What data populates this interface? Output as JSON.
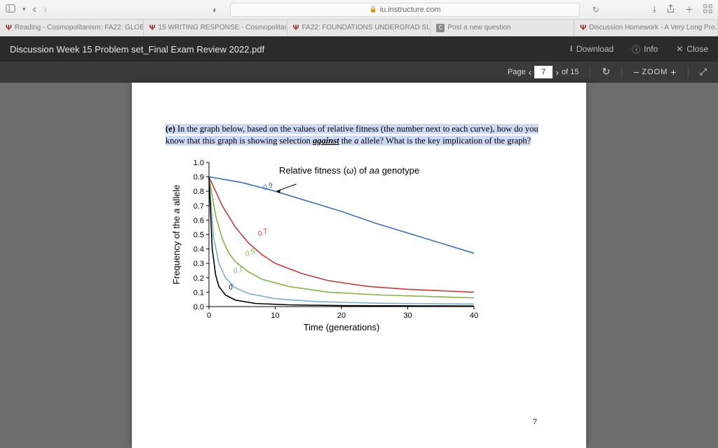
{
  "browser": {
    "url": "iu.instructure.com",
    "tabs": [
      {
        "icon": "psi",
        "label": "Reading - Cosmopolitanism: FA22: GLOB..."
      },
      {
        "icon": "psi",
        "label": "15 WRITING RESPONSE - Cosmopolitani..."
      },
      {
        "icon": "psi",
        "label": "FA22: FOUNDATIONS UNDERGRAD SUC..."
      },
      {
        "icon": "c",
        "label": "Post a new question"
      },
      {
        "icon": "psi",
        "label": "Discussion Homework - A Very Long Pro..."
      }
    ]
  },
  "viewer": {
    "title": "Discussion Week 15 Problem set_Final Exam Review 2022.pdf",
    "download": "Download",
    "info": "Info",
    "close": "Close",
    "page_label": "Page",
    "page_current": "7",
    "page_total": "of 15",
    "zoom_label": "ZOOM"
  },
  "document": {
    "question_label": "(e)",
    "question_part1": "In the graph below, based on the values of relative fitness (the number next to each curve), how do you know that this graph is showing selection ",
    "against": "against",
    "question_part2": " the ",
    "allele": "a",
    "question_part3": " allele?  What is the key implication of the graph?",
    "page_number": "7"
  },
  "chart_data": {
    "type": "line",
    "title": "Relative fitness (ω) of aa genotype",
    "xlabel": "Time (generations)",
    "ylabel": "Frequency of the a allele",
    "xlim": [
      0,
      40
    ],
    "ylim": [
      0,
      1.0
    ],
    "xticks": [
      0,
      10,
      20,
      30,
      40
    ],
    "yticks": [
      0.0,
      0.1,
      0.2,
      0.3,
      0.4,
      0.5,
      0.6,
      0.7,
      0.8,
      0.9,
      1.0
    ],
    "series": [
      {
        "name": "0.9",
        "color": "#3a6fb7",
        "label_pos": [
          9,
          0.82
        ],
        "points": [
          [
            0,
            0.9
          ],
          [
            5,
            0.86
          ],
          [
            10,
            0.8
          ],
          [
            15,
            0.73
          ],
          [
            20,
            0.66
          ],
          [
            25,
            0.58
          ],
          [
            30,
            0.51
          ],
          [
            35,
            0.44
          ],
          [
            40,
            0.37
          ]
        ]
      },
      {
        "name": "0.7",
        "color": "#c23a3a",
        "label_pos": [
          8.2,
          0.5
        ],
        "points": [
          [
            0,
            0.9
          ],
          [
            2,
            0.7
          ],
          [
            4,
            0.55
          ],
          [
            6,
            0.44
          ],
          [
            8,
            0.36
          ],
          [
            10,
            0.3
          ],
          [
            14,
            0.23
          ],
          [
            18,
            0.18
          ],
          [
            24,
            0.14
          ],
          [
            30,
            0.12
          ],
          [
            40,
            0.1
          ]
        ]
      },
      {
        "name": "0.5",
        "color": "#86b24a",
        "label_pos": [
          6.3,
          0.36
        ],
        "points": [
          [
            0,
            0.9
          ],
          [
            1,
            0.63
          ],
          [
            2,
            0.47
          ],
          [
            3,
            0.37
          ],
          [
            4,
            0.31
          ],
          [
            6,
            0.24
          ],
          [
            8,
            0.19
          ],
          [
            12,
            0.14
          ],
          [
            18,
            0.1
          ],
          [
            26,
            0.08
          ],
          [
            40,
            0.06
          ]
        ]
      },
      {
        "name": "0.1",
        "color": "#7bb0c9",
        "label_pos": [
          4.5,
          0.24
        ],
        "points": [
          [
            0,
            0.9
          ],
          [
            0.7,
            0.48
          ],
          [
            1.5,
            0.3
          ],
          [
            2.5,
            0.2
          ],
          [
            4,
            0.13
          ],
          [
            6,
            0.09
          ],
          [
            10,
            0.055
          ],
          [
            16,
            0.035
          ],
          [
            26,
            0.023
          ],
          [
            40,
            0.018
          ]
        ]
      },
      {
        "name": "0",
        "color": "#000000",
        "label_pos": [
          3.4,
          0.12
        ],
        "points": [
          [
            0,
            0.9
          ],
          [
            0.5,
            0.4
          ],
          [
            1,
            0.22
          ],
          [
            1.5,
            0.14
          ],
          [
            2.5,
            0.08
          ],
          [
            4,
            0.045
          ],
          [
            7,
            0.022
          ],
          [
            12,
            0.012
          ],
          [
            20,
            0.007
          ],
          [
            40,
            0.004
          ]
        ]
      }
    ],
    "arrow": {
      "from": [
        13.2,
        0.85
      ],
      "to": [
        10.2,
        0.8
      ]
    }
  }
}
